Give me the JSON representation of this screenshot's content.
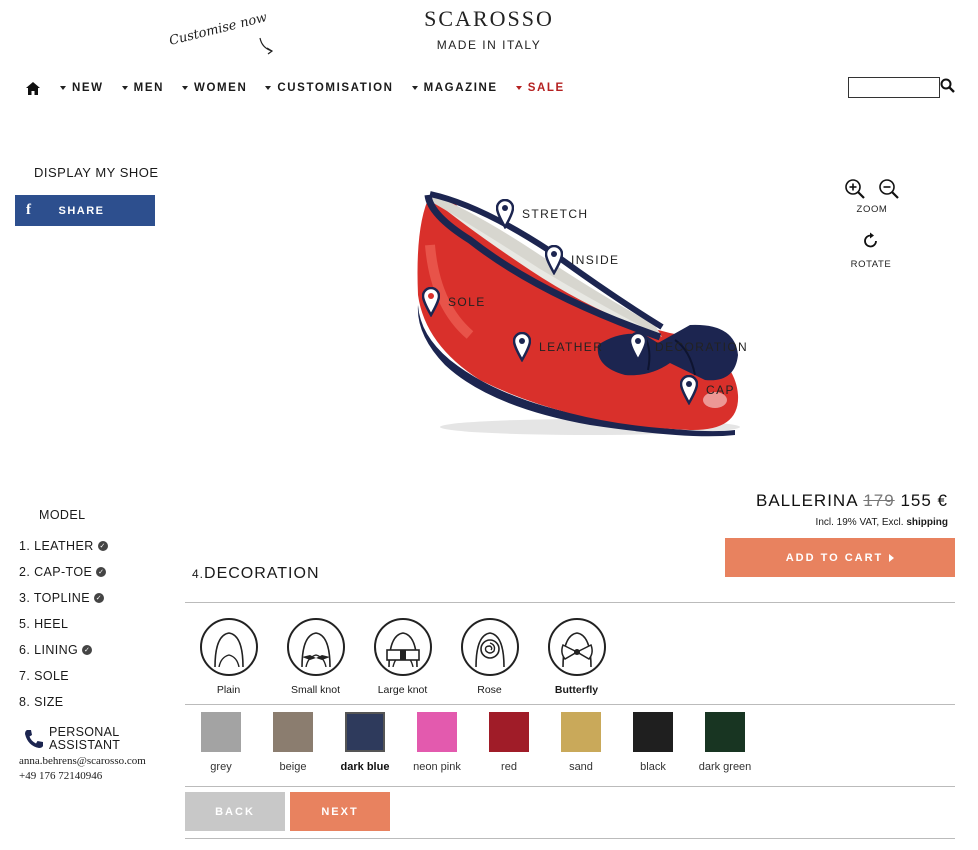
{
  "brand": {
    "name": "SCAROSSO",
    "tagline": "MADE IN ITALY",
    "customise_note": "Customise now"
  },
  "nav": {
    "items": [
      {
        "label": "NEW"
      },
      {
        "label": "MEN"
      },
      {
        "label": "WOMEN"
      },
      {
        "label": "CUSTOMISATION"
      },
      {
        "label": "MAGAZINE"
      },
      {
        "label": "SALE"
      }
    ],
    "search": {
      "value": "",
      "placeholder": ""
    }
  },
  "left": {
    "display_label": "DISPLAY MY SHOE",
    "share_label": "SHARE"
  },
  "viewer": {
    "hotspots": [
      "STRETCH",
      "INSIDE",
      "SOLE",
      "LEATHER",
      "DECORATION",
      "CAP"
    ],
    "zoom_label": "ZOOM",
    "rotate_label": "ROTATE"
  },
  "product": {
    "name": "BALLERINA",
    "old_price": "179",
    "price": "155 €",
    "vat_text": "Incl. 19% VAT, Excl.",
    "shipping_link": "shipping",
    "cart_label": "ADD TO CART"
  },
  "steps": {
    "model_label": "MODEL",
    "items": [
      {
        "label": "1. LEATHER",
        "done": true
      },
      {
        "label": "2. CAP-TOE",
        "done": true
      },
      {
        "label": "3. TOPLINE",
        "done": true
      },
      {
        "label": "5. HEEL",
        "done": false
      },
      {
        "label": "6. LINING",
        "done": true
      },
      {
        "label": "7. SOLE",
        "done": false
      },
      {
        "label": "8. SIZE",
        "done": false
      }
    ]
  },
  "assistant": {
    "title_line1": "PERSONAL",
    "title_line2": "ASSISTANT",
    "email": "anna.behrens@scarosso.com",
    "phone": "+49 176 72140946"
  },
  "section": {
    "number": "4.",
    "title": "DECORATION"
  },
  "styles": [
    {
      "label": "Plain",
      "selected": false
    },
    {
      "label": "Small knot",
      "selected": false
    },
    {
      "label": "Large knot",
      "selected": false
    },
    {
      "label": "Rose",
      "selected": false
    },
    {
      "label": "Butterfly",
      "selected": true
    }
  ],
  "colors": [
    {
      "label": "grey",
      "hex": "#a3a3a3",
      "selected": false
    },
    {
      "label": "beige",
      "hex": "#8b7d6f",
      "selected": false
    },
    {
      "label": "dark blue",
      "hex": "#2e3a5c",
      "selected": true
    },
    {
      "label": "neon pink",
      "hex": "#e35aae",
      "selected": false
    },
    {
      "label": "red",
      "hex": "#a01c28",
      "selected": false
    },
    {
      "label": "sand",
      "hex": "#c9a95a",
      "selected": false
    },
    {
      "label": "black",
      "hex": "#1f1f1f",
      "selected": false
    },
    {
      "label": "dark green",
      "hex": "#183522",
      "selected": false
    }
  ],
  "buttons": {
    "back": "BACK",
    "next": "NEXT"
  },
  "theme": {
    "accent": "#e8825f",
    "facebook": "#2d4f8e",
    "sale": "#b52121",
    "shoe_red": "#d9302b",
    "shoe_trim": "#1c2550"
  }
}
